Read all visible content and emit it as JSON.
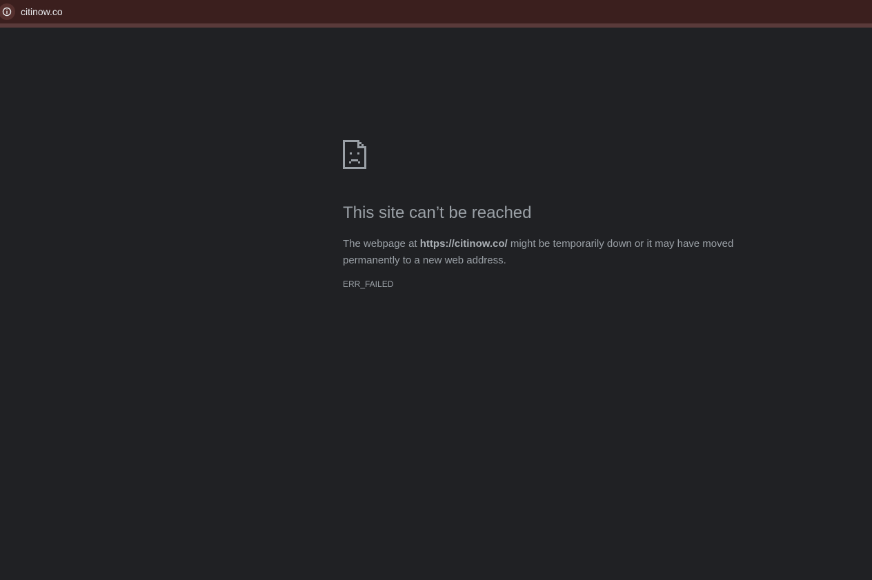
{
  "address_bar": {
    "url": "citinow.co",
    "site_info_icon": "info-circle-icon"
  },
  "error_page": {
    "icon": "sad-page-icon",
    "title": "This site can’t be reached",
    "desc_prefix": "The webpage at ",
    "desc_url": "https://citinow.co/",
    "desc_suffix": " might be temporarily down or it may have moved permanently to a new web address.",
    "error_code": "ERR_FAILED"
  },
  "colors": {
    "page_background": "#202124",
    "topbar_background": "#3b1f1e",
    "text_secondary": "#9aa0a6",
    "url_text": "#e8eaed"
  }
}
